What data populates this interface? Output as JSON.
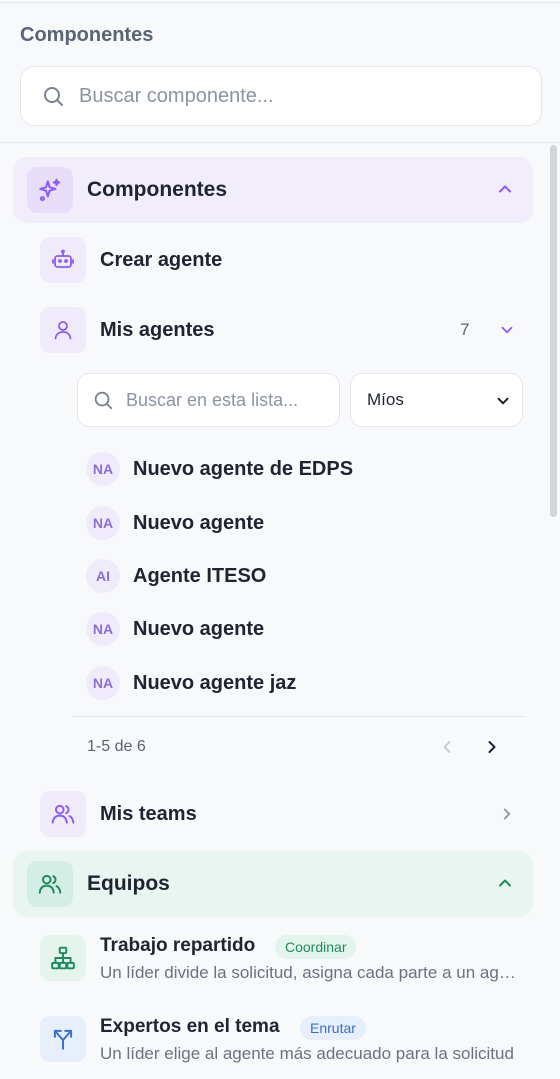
{
  "panel": {
    "title": "Componentes",
    "search_placeholder": "Buscar componente..."
  },
  "componentes": {
    "label": "Componentes",
    "crear_agente": "Crear agente",
    "mis_agentes": {
      "label": "Mis agentes",
      "count": "7",
      "search_placeholder": "Buscar en esta lista...",
      "filter_selected": "Míos",
      "items": [
        {
          "initials": "NA",
          "name": "Nuevo agente de EDPS"
        },
        {
          "initials": "NA",
          "name": "Nuevo agente"
        },
        {
          "initials": "AI",
          "name": "Agente ITESO"
        },
        {
          "initials": "NA",
          "name": "Nuevo agente"
        },
        {
          "initials": "NA",
          "name": "Nuevo agente jaz"
        }
      ],
      "pagination": "1-5 de 6"
    },
    "mis_teams": "Mis teams"
  },
  "equipos": {
    "label": "Equipos",
    "items": [
      {
        "title": "Trabajo repartido",
        "tag": "Coordinar",
        "description": "Un líder divide la solicitud, asigna cada parte a un agente"
      },
      {
        "title": "Expertos en el tema",
        "tag": "Enrutar",
        "description": "Un líder elige al agente más adecuado para la solicitud"
      }
    ]
  },
  "colors": {
    "accent_purple": "#8b6fd6",
    "accent_green": "#1f8a5c",
    "accent_blue": "#3a6fd0"
  },
  "icons": [
    "search-icon",
    "sparkles-icon",
    "chevron-up-icon",
    "robot-icon",
    "user-icon",
    "chevron-down-icon",
    "chevron-left-icon",
    "chevron-right-icon",
    "users-icon",
    "hierarchy-icon",
    "split-arrow-icon"
  ]
}
